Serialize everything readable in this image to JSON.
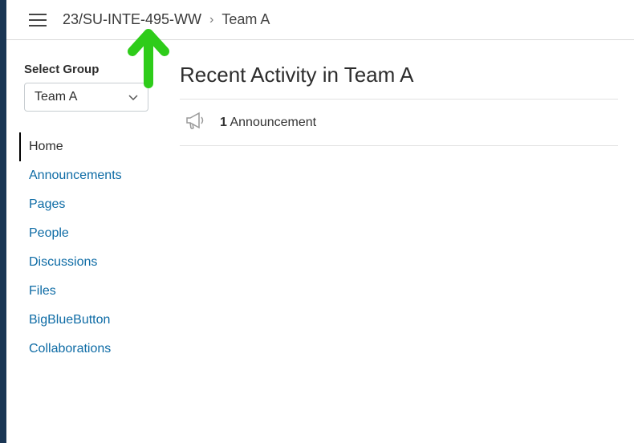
{
  "breadcrumb": {
    "course": "23/SU-INTE-495-WW",
    "separator": "›",
    "current": "Team A"
  },
  "sidebar": {
    "select_label": "Select Group",
    "selected_group": "Team A",
    "nav": [
      {
        "label": "Home",
        "active": true
      },
      {
        "label": "Announcements",
        "active": false
      },
      {
        "label": "Pages",
        "active": false
      },
      {
        "label": "People",
        "active": false
      },
      {
        "label": "Discussions",
        "active": false
      },
      {
        "label": "Files",
        "active": false
      },
      {
        "label": "BigBlueButton",
        "active": false
      },
      {
        "label": "Collaborations",
        "active": false
      }
    ]
  },
  "main": {
    "title": "Recent Activity in Team A",
    "activity": {
      "count": "1",
      "label": "Announcement"
    }
  },
  "annotation": {
    "color": "#2ecc1a"
  }
}
